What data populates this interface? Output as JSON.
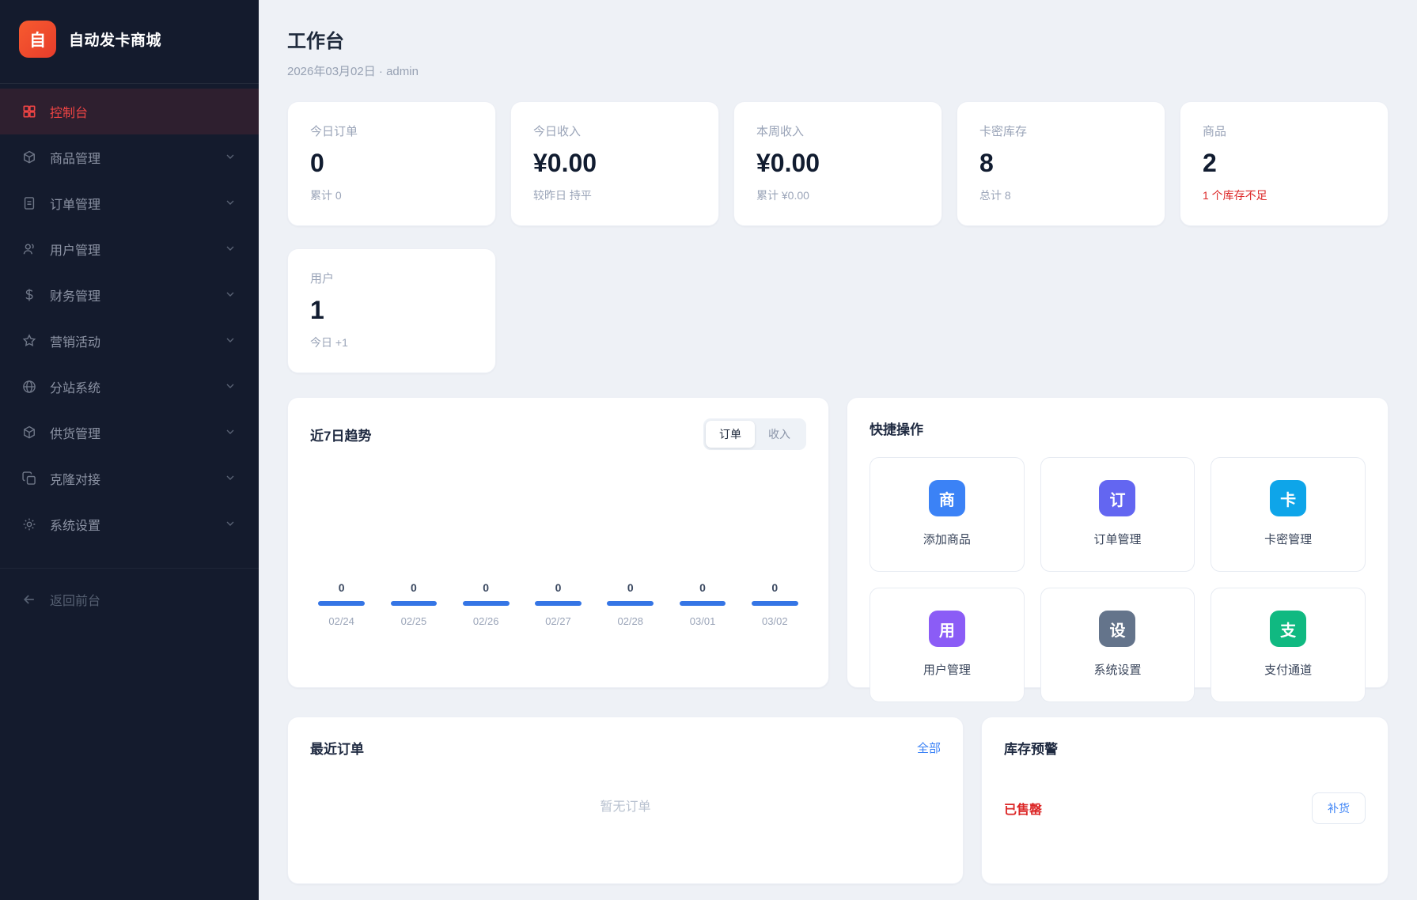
{
  "app": {
    "logo_char": "自",
    "title": "自动发卡商城"
  },
  "sidebar": {
    "items": [
      {
        "label": "控制台",
        "icon": "dashboard-grid-icon",
        "active": true,
        "expandable": false
      },
      {
        "label": "商品管理",
        "icon": "cube-icon",
        "active": false,
        "expandable": true
      },
      {
        "label": "订单管理",
        "icon": "document-icon",
        "active": false,
        "expandable": true
      },
      {
        "label": "用户管理",
        "icon": "users-icon",
        "active": false,
        "expandable": true
      },
      {
        "label": "财务管理",
        "icon": "dollar-icon",
        "active": false,
        "expandable": true
      },
      {
        "label": "营销活动",
        "icon": "star-icon",
        "active": false,
        "expandable": true
      },
      {
        "label": "分站系统",
        "icon": "globe-icon",
        "active": false,
        "expandable": true
      },
      {
        "label": "供货管理",
        "icon": "cube-icon",
        "active": false,
        "expandable": true
      },
      {
        "label": "克隆对接",
        "icon": "copy-icon",
        "active": false,
        "expandable": true
      },
      {
        "label": "系统设置",
        "icon": "gear-icon",
        "active": false,
        "expandable": true
      }
    ],
    "back": {
      "label": "返回前台",
      "icon": "arrow-left-icon"
    }
  },
  "header": {
    "title": "工作台",
    "subtitle": "2026年03月02日 · admin"
  },
  "stats": [
    {
      "label": "今日订单",
      "value": "0",
      "sub": "累计 0"
    },
    {
      "label": "今日收入",
      "value": "¥0.00",
      "sub": "较昨日 持平"
    },
    {
      "label": "本周收入",
      "value": "¥0.00",
      "sub": "累计 ¥0.00"
    },
    {
      "label": "卡密库存",
      "value": "8",
      "sub": "总计 8"
    },
    {
      "label": "商品",
      "value": "2",
      "sub": "1 个库存不足",
      "alert": true
    },
    {
      "label": "用户",
      "value": "1",
      "sub": "今日 +1"
    }
  ],
  "trend": {
    "title": "近7日趋势",
    "tabs": [
      {
        "label": "订单",
        "active": true
      },
      {
        "label": "收入",
        "active": false
      }
    ],
    "chart_data": {
      "type": "bar",
      "title": "近7日趋势",
      "categories": [
        "02/24",
        "02/25",
        "02/26",
        "02/27",
        "02/28",
        "03/01",
        "03/02"
      ],
      "values": [
        0,
        0,
        0,
        0,
        0,
        0,
        0
      ],
      "xlabel": "",
      "ylabel": "",
      "ylim": [
        0,
        1
      ],
      "grid": false,
      "value_labels_shown": true,
      "bar_color": "#3575e5"
    }
  },
  "quick_actions": {
    "title": "快捷操作",
    "items": [
      {
        "label": "添加商品",
        "badge_char": "商",
        "color": "#3b82f6"
      },
      {
        "label": "订单管理",
        "badge_char": "订",
        "color": "#6366f1"
      },
      {
        "label": "卡密管理",
        "badge_char": "卡",
        "color": "#0ea5e9"
      },
      {
        "label": "用户管理",
        "badge_char": "用",
        "color": "#8b5cf6"
      },
      {
        "label": "系统设置",
        "badge_char": "设",
        "color": "#64748b"
      },
      {
        "label": "支付通道",
        "badge_char": "支",
        "color": "#10b981"
      }
    ]
  },
  "recent_orders": {
    "title": "最近订单",
    "view_all": "全部",
    "empty_text": "暂无订单"
  },
  "stock_alert": {
    "title": "库存预警",
    "status_text": "已售罄",
    "action_label": "补货"
  },
  "colors": {
    "sidebar_bg": "#141b2d",
    "accent_red": "#ef4444",
    "alert_red": "#dc2626",
    "link_blue": "#3b82f6",
    "bar_blue": "#3575e5",
    "logo_gradient_start": "#f75b2f",
    "logo_gradient_end": "#e73c2b"
  }
}
